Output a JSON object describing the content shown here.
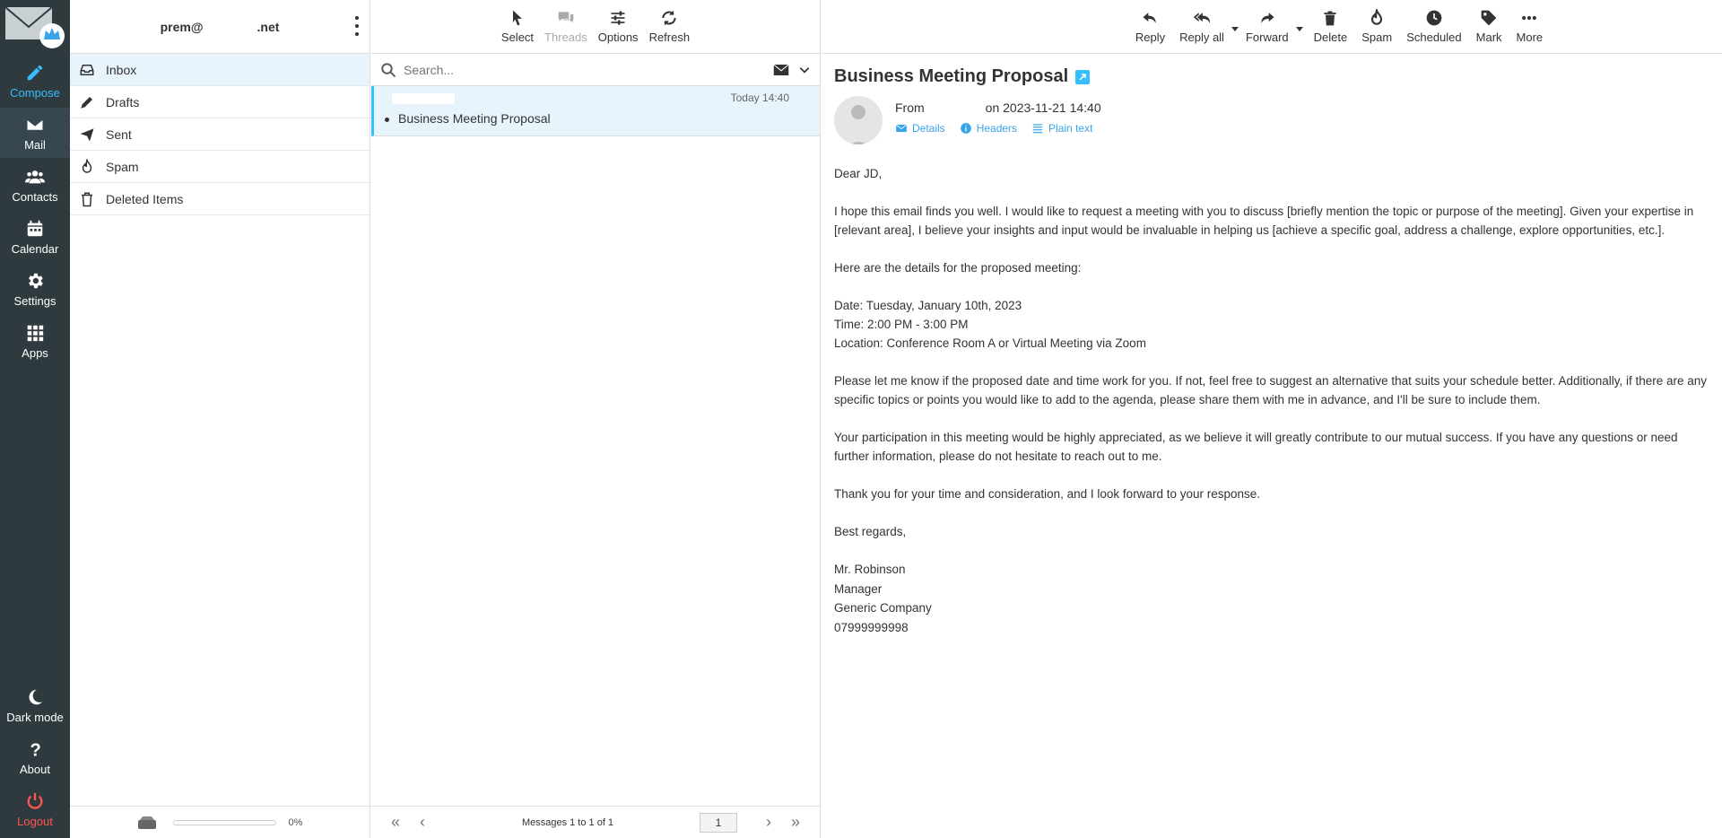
{
  "account": {
    "prefix": "prem@",
    "suffix": ".net"
  },
  "nav": {
    "compose": "Compose",
    "mail": "Mail",
    "contacts": "Contacts",
    "calendar": "Calendar",
    "settings": "Settings",
    "apps": "Apps",
    "dark_mode": "Dark mode",
    "about": "About",
    "logout": "Logout"
  },
  "folders": [
    "Inbox",
    "Drafts",
    "Sent",
    "Spam",
    "Deleted Items"
  ],
  "quota": {
    "percent": "0%",
    "fill": 0
  },
  "list_toolbar": {
    "select": "Select",
    "threads": "Threads",
    "options": "Options",
    "refresh": "Refresh"
  },
  "search": {
    "placeholder": "Search..."
  },
  "messages": [
    {
      "date": "Today 14:40",
      "subject": "Business Meeting Proposal"
    }
  ],
  "pager": {
    "info": "Messages 1 to 1 of 1",
    "page": "1"
  },
  "view_toolbar": {
    "reply": "Reply",
    "reply_all": "Reply all",
    "forward": "Forward",
    "delete": "Delete",
    "spam": "Spam",
    "scheduled": "Scheduled",
    "mark": "Mark",
    "more": "More"
  },
  "email": {
    "subject": "Business Meeting Proposal",
    "from_label": "From",
    "date_text": "on 2023-11-21 14:40",
    "links": {
      "details": "Details",
      "headers": "Headers",
      "plain_text": "Plain text"
    },
    "greeting": "Dear JD,",
    "p1": "I hope this email finds you well. I would like to request a meeting with you to discuss [briefly mention the topic or purpose of the meeting]. Given your expertise in [relevant area], I believe your insights and input would be invaluable in helping us [achieve a specific goal, address a challenge, explore opportunities, etc.].",
    "p2": "Here are the details for the proposed meeting:",
    "date_line": "Date: Tuesday, January 10th, 2023",
    "time_line": "Time: 2:00 PM - 3:00 PM",
    "location_line": "Location: Conference Room A or Virtual Meeting via Zoom",
    "p3": "Please let me know if the proposed date and time work for you. If not, feel free to suggest an alternative that suits your schedule better. Additionally, if there are any specific topics or points you would like to add to the agenda, please share them with me in advance, and I'll be sure to include them.",
    "p4": "Your participation in this meeting would be highly appreciated, as we believe it will greatly contribute to our mutual success. If you have any questions or need further information, please do not hesitate to reach out to me.",
    "p5": "Thank you for your time and consideration, and I look forward to your response.",
    "closing": "Best regards,",
    "sig_name": "Mr. Robinson",
    "sig_title": "Manager",
    "sig_company": "Generic Company",
    "sig_phone": "07999999998"
  },
  "colors": {
    "accent": "#37beff",
    "nav_bg": "#2f3a3f",
    "logout": "#ff5552",
    "selected": "#e8f4fb"
  }
}
